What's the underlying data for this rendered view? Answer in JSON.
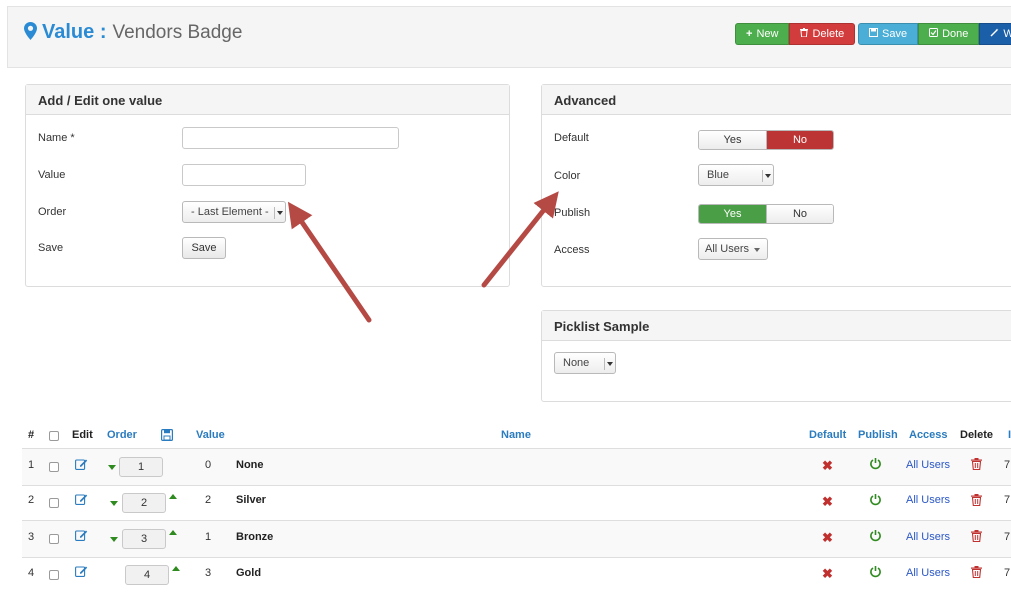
{
  "header": {
    "title_accent": "Value :",
    "title_sub": "Vendors Badge"
  },
  "toolbar": {
    "new_label": "New",
    "delete_label": "Delete",
    "save_label": "Save",
    "done_label": "Done",
    "wizard_label": "W"
  },
  "edit_panel": {
    "title": "Add / Edit one value",
    "name_label": "Name *",
    "name_value": "",
    "value_label": "Value",
    "value_value": "",
    "order_label": "Order",
    "order_selected": "- Last Element -",
    "save_label": "Save",
    "save_button": "Save"
  },
  "advanced_panel": {
    "title": "Advanced",
    "default_label": "Default",
    "default_yes": "Yes",
    "default_no": "No",
    "color_label": "Color",
    "color_selected": "Blue",
    "publish_label": "Publish",
    "publish_yes": "Yes",
    "publish_no": "No",
    "access_label": "Access",
    "access_selected": "All Users"
  },
  "picklist_panel": {
    "title": "Picklist Sample",
    "selected": "None"
  },
  "table": {
    "headers": {
      "num": "#",
      "edit": "Edit",
      "order": "Order",
      "value": "Value",
      "name": "Name",
      "default": "Default",
      "publish": "Publish",
      "access": "Access",
      "delete": "Delete",
      "id": "I"
    },
    "rows": [
      {
        "num": "1",
        "order": "1",
        "value": "0",
        "name": "None",
        "access": "All Users",
        "id": "7"
      },
      {
        "num": "2",
        "order": "2",
        "value": "2",
        "name": "Silver",
        "access": "All Users",
        "id": "7"
      },
      {
        "num": "3",
        "order": "3",
        "value": "1",
        "name": "Bronze",
        "access": "All Users",
        "id": "7"
      },
      {
        "num": "4",
        "order": "4",
        "value": "3",
        "name": "Gold",
        "access": "All Users",
        "id": "7"
      }
    ]
  },
  "colors": {
    "accent": "#2a8bd4",
    "new_button": "#4cae4c",
    "delete_button": "#d33c3c",
    "save_button": "#4aaed6",
    "wizard_button": "#1c5fa9",
    "toggle_no": "#bd3434",
    "toggle_yes": "#4a9e45",
    "annotation_arrow": "#b54a45"
  },
  "icons": {
    "title": "map-pin-icon",
    "new": "plus-icon",
    "delete": "trash-icon",
    "save": "floppy-icon",
    "done": "check-square-icon",
    "wizard": "wand-icon",
    "order_save": "floppy-icon",
    "edit": "edit-icon",
    "default": "x-icon",
    "publish": "power-icon",
    "row_delete": "trash-icon"
  }
}
